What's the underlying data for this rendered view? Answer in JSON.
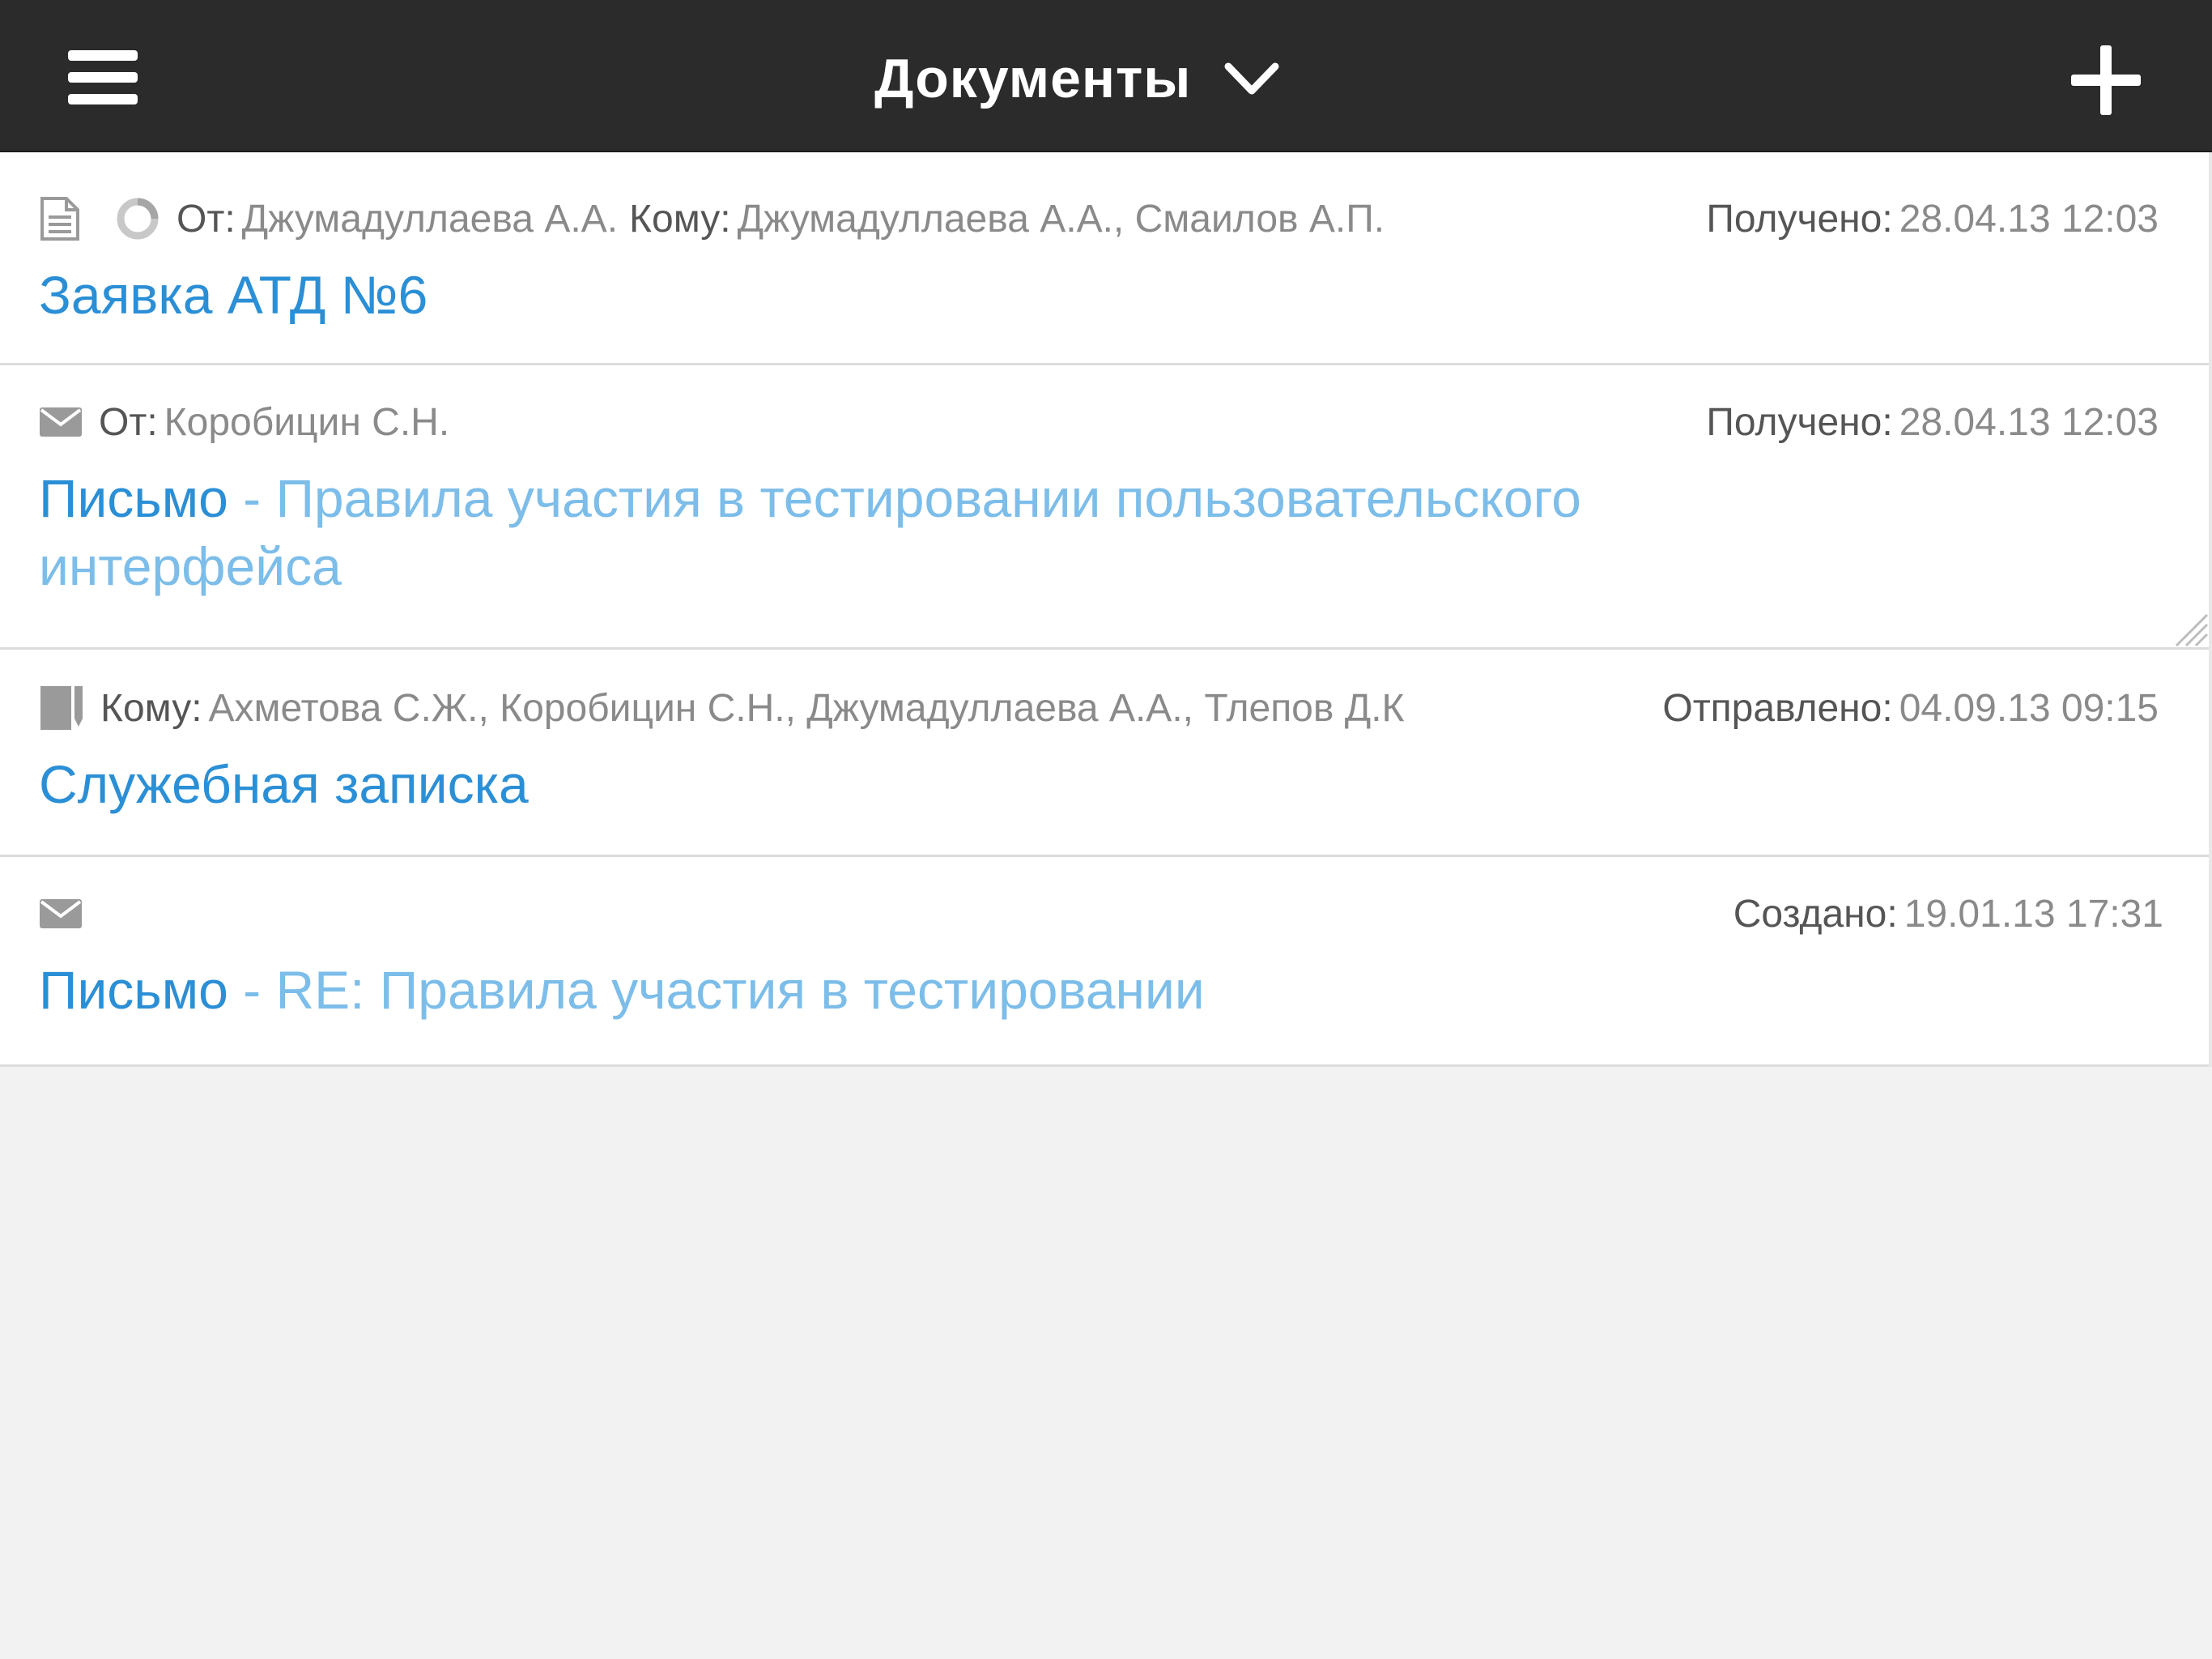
{
  "header": {
    "title": "Документы"
  },
  "documents": [
    {
      "from_label": "От:",
      "from": "Джумадуллаева А.А.",
      "to_label": "Кому:",
      "to": "Джумадуллаева А.А., Смаилов А.П.",
      "date_label": "Получено:",
      "date": "28.04.13 12:03",
      "title": "Заявка АТД №6",
      "icons": [
        "document-icon",
        "status-circle-icon"
      ]
    },
    {
      "from_label": "От:",
      "from": "Коробицин С.Н.",
      "date_label": "Получено:",
      "date": "28.04.13 12:03",
      "type": "Письмо",
      "separator": "-",
      "title_line1": "Правила участия в тестировании пользовательского",
      "title_line2": "интерфейса",
      "icons": [
        "envelope-icon"
      ]
    },
    {
      "to_label": "Кому:",
      "to": "Ахметова С.Ж., Коробицин С.Н., Джумадуллаева А.А., Тлепов Д.К",
      "date_label": "Отправлено:",
      "date": "04.09.13 09:15",
      "title": "Служебная записка",
      "icons": [
        "memo-icon"
      ]
    },
    {
      "date_label": "Создано:",
      "date": "19.01.13 17:31",
      "type": "Письмо",
      "separator": "-",
      "title": "RE: Правила участия в тестировании",
      "icons": [
        "envelope-icon"
      ]
    }
  ],
  "colors": {
    "topbar": "#2b2b2b",
    "link": "#2b8fd6",
    "link_light": "#7cbde9",
    "label": "#555555",
    "value": "#8a8a8a",
    "background": "#f2f2f2"
  }
}
